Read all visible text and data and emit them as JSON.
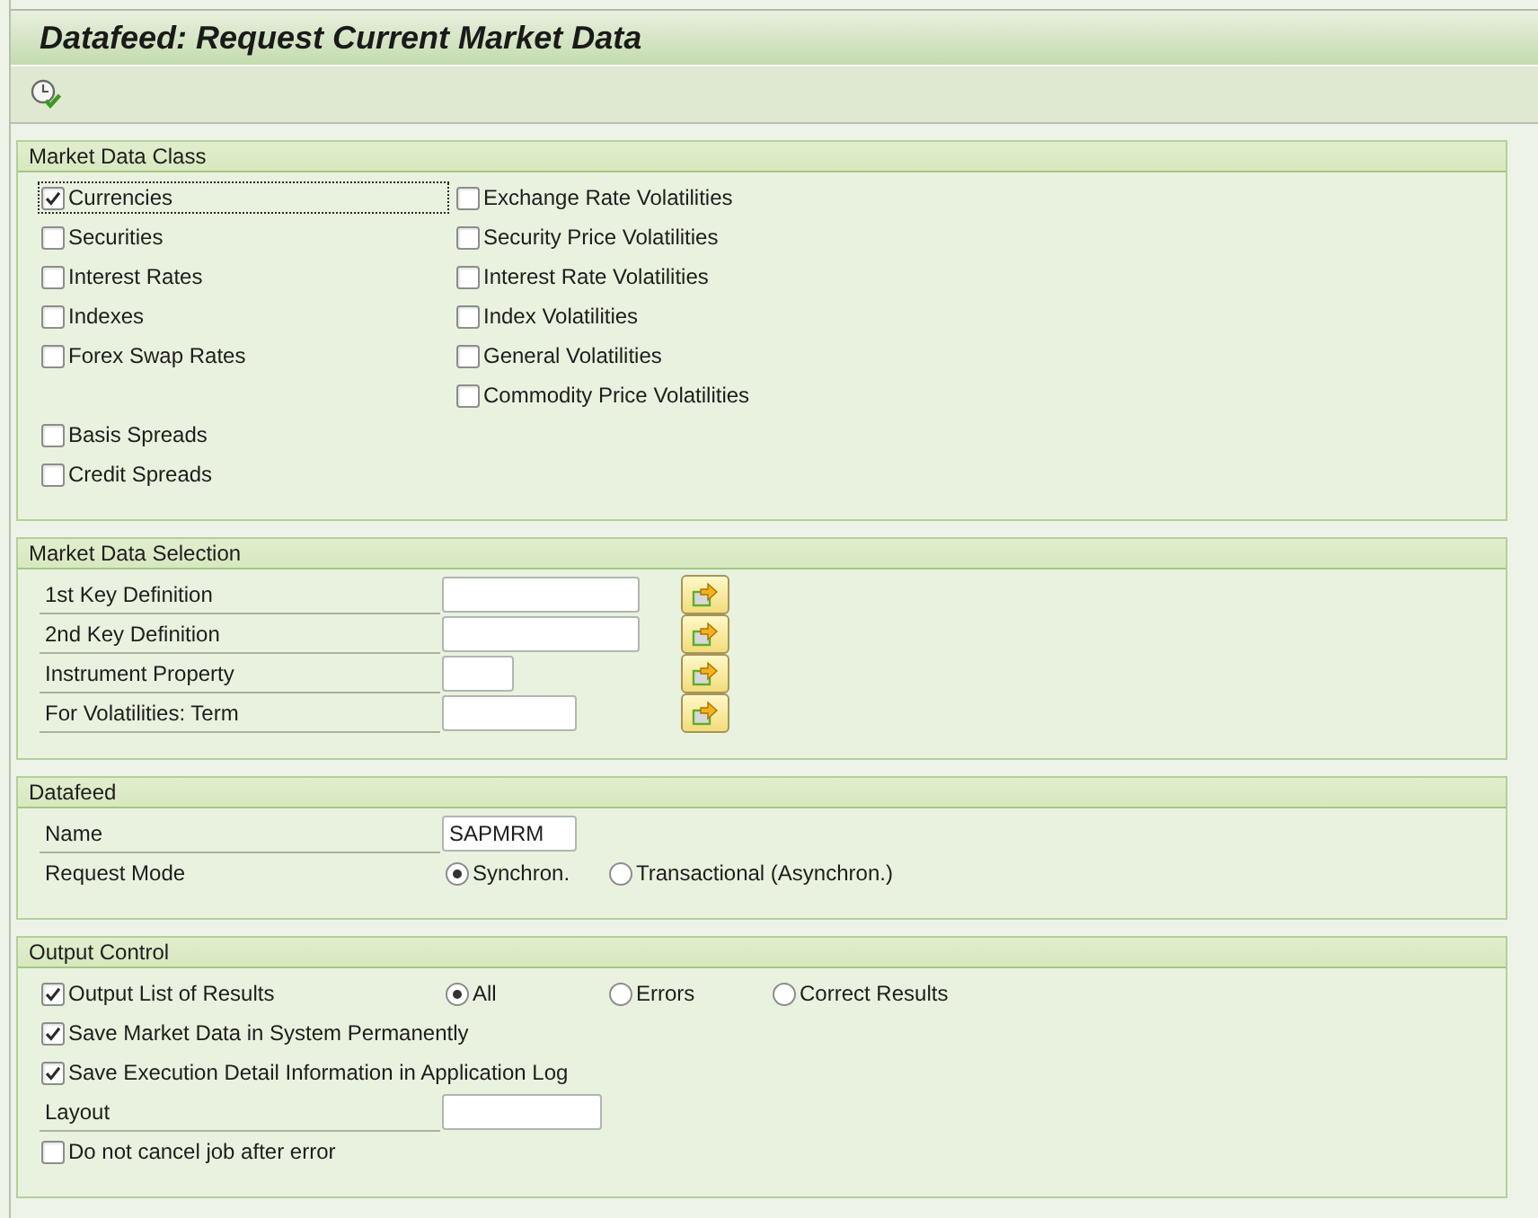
{
  "window": {
    "title": "Datafeed: Request Current Market Data"
  },
  "market_data_class": {
    "title": "Market Data Class",
    "rows": [
      {
        "left": {
          "label": "Currencies",
          "checked": true,
          "focused": true
        },
        "right": {
          "label": "Exchange Rate Volatilities",
          "checked": false,
          "focused": false
        }
      },
      {
        "left": {
          "label": "Securities",
          "checked": false,
          "focused": false
        },
        "right": {
          "label": "Security Price Volatilities",
          "checked": false,
          "focused": false
        }
      },
      {
        "left": {
          "label": "Interest Rates",
          "checked": false,
          "focused": false
        },
        "right": {
          "label": "Interest Rate Volatilities",
          "checked": false,
          "focused": false
        }
      },
      {
        "left": {
          "label": "Indexes",
          "checked": false,
          "focused": false
        },
        "right": {
          "label": "Index Volatilities",
          "checked": false,
          "focused": false
        }
      },
      {
        "left": {
          "label": "Forex Swap Rates",
          "checked": false,
          "focused": false
        },
        "right": {
          "label": "General Volatilities",
          "checked": false,
          "focused": false
        }
      },
      {
        "right": {
          "label": "Commodity Price Volatilities",
          "checked": false,
          "focused": false
        }
      },
      {
        "left": {
          "label": "Basis Spreads",
          "checked": false,
          "focused": false
        }
      },
      {
        "left": {
          "label": "Credit Spreads",
          "checked": false,
          "focused": false
        }
      }
    ]
  },
  "market_data_selection": {
    "title": "Market Data Selection",
    "fields": [
      {
        "label": "1st Key Definition"
      },
      {
        "label": "2nd Key Definition"
      },
      {
        "label": "Instrument Property"
      },
      {
        "label": "For Volatilities: Term"
      }
    ]
  },
  "datafeed": {
    "title": "Datafeed",
    "name": {
      "label": "Name",
      "value": "SAPMRM"
    },
    "request_mode": {
      "label": "Request Mode",
      "options": [
        {
          "label": "Synchron.",
          "selected": true
        },
        {
          "label": "Transactional (Asynchron.)",
          "selected": false
        }
      ]
    }
  },
  "output_control": {
    "title": "Output Control",
    "rows": [
      {
        "kind": "checkbox",
        "label": "Output List of Results",
        "checked": true,
        "options": [
          {
            "label": "All",
            "selected": true
          },
          {
            "label": "Errors",
            "selected": false
          },
          {
            "label": "Correct Results",
            "selected": false
          }
        ]
      },
      {
        "kind": "checkbox",
        "label": "Save Market Data in System Permanently",
        "checked": true
      },
      {
        "kind": "checkbox",
        "label": "Save Execution Detail Information in Application Log",
        "checked": true
      },
      {
        "kind": "field",
        "label": "Layout"
      },
      {
        "kind": "checkbox",
        "label": "Do not cancel job after error",
        "checked": false
      }
    ]
  }
}
